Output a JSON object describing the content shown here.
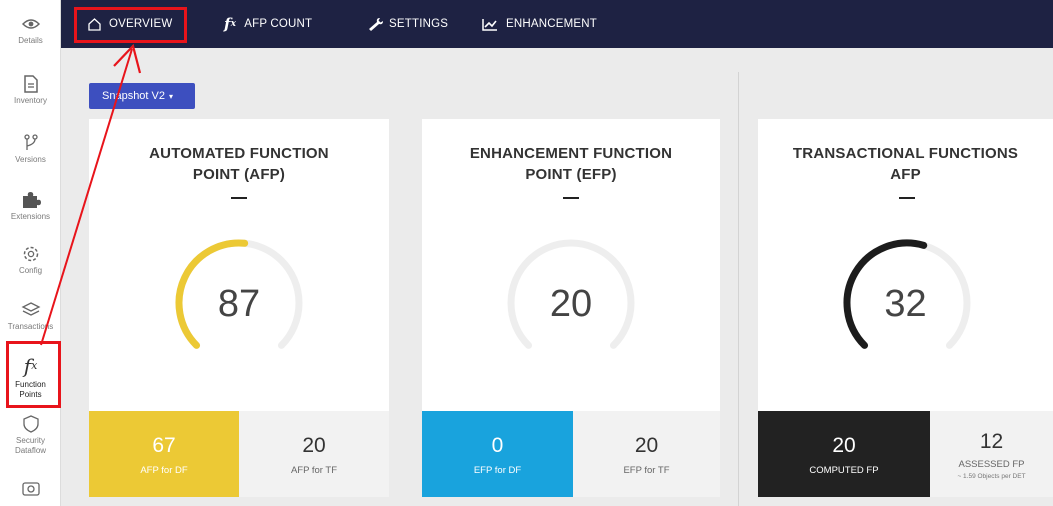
{
  "sidebar": {
    "items": [
      {
        "label": "Details",
        "icon": "eye-icon"
      },
      {
        "label": "Inventory",
        "icon": "document-icon"
      },
      {
        "label": "Versions",
        "icon": "branch-icon"
      },
      {
        "label": "Extensions",
        "icon": "puzzle-icon"
      },
      {
        "label": "Config",
        "icon": "gear-icon"
      },
      {
        "label": "Transactions",
        "icon": "layers-icon"
      },
      {
        "label_line1": "Function",
        "label_line2": "Points",
        "icon": "fx-icon",
        "glyph": "f",
        "glyph_sub": "x"
      },
      {
        "label_line1": "Security",
        "label_line2": "Dataflow",
        "icon": "shield-icon"
      },
      {
        "icon": "camera-icon"
      }
    ]
  },
  "topnav": {
    "tabs": [
      {
        "label": "OVERVIEW",
        "icon": "home-icon"
      },
      {
        "label": "AFP COUNT",
        "icon": "fx-icon",
        "glyph": "f",
        "glyph_sub": "x"
      },
      {
        "label": "SETTINGS",
        "icon": "wrench-icon"
      },
      {
        "label": "ENHANCEMENT",
        "icon": "trend-chart-icon"
      }
    ]
  },
  "snapshot": {
    "label": "Snapshot V2",
    "caret": "▾"
  },
  "cards": [
    {
      "title_line1": "AUTOMATED FUNCTION",
      "title_line2": "POINT (AFP)",
      "dash": "—",
      "value": "87",
      "gauge_fraction": 0.52,
      "gauge_color": "#ecc935",
      "left": {
        "value": "67",
        "label": "AFP for DF",
        "bg": "#ecc935"
      },
      "right": {
        "value": "20",
        "label": "AFP for TF"
      }
    },
    {
      "title_line1": "ENHANCEMENT FUNCTION",
      "title_line2": "POINT (EFP)",
      "dash": "—",
      "value": "20",
      "gauge_fraction": 0.0,
      "gauge_color": "#19a3dd",
      "left": {
        "value": "0",
        "label": "EFP for DF",
        "bg": "#19a3dd"
      },
      "right": {
        "value": "20",
        "label": "EFP for TF"
      }
    },
    {
      "title_line1": "TRANSACTIONAL FUNCTIONS",
      "title_line2": "AFP",
      "dash": "—",
      "value": "32",
      "gauge_fraction": 0.56,
      "gauge_color": "#1c1c1c",
      "left": {
        "value": "20",
        "label": "COMPUTED FP",
        "bg": "#222222"
      },
      "right": {
        "value": "12",
        "label": "ASSESSED FP",
        "sub": "~ 1.59 Objects per DET"
      }
    }
  ],
  "colors": {
    "topbar": "#1e2243",
    "annotation": "#e8141b",
    "gauge_track": "#eeeeee"
  }
}
